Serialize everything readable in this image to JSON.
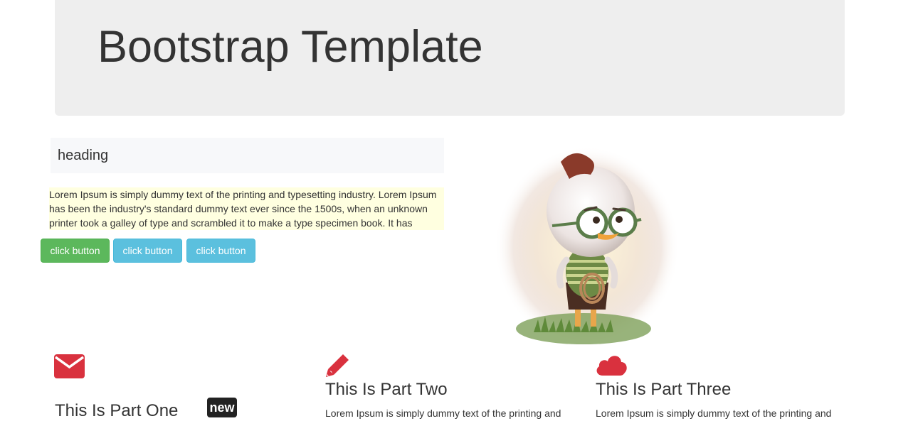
{
  "jumbotron": {
    "title": "Bootstrap Template"
  },
  "panel": {
    "heading": "heading"
  },
  "intro": {
    "text": "Lorem Ipsum is simply dummy text of the printing and typesetting industry. Lorem Ipsum has been the industry's standard dummy text ever since the 1500s, when an unknown printer took a galley of type and scrambled it to make a type specimen book. It has"
  },
  "buttons": [
    {
      "label": "click button",
      "style": "success",
      "color": "#5cb85c"
    },
    {
      "label": "click button",
      "style": "info",
      "color": "#5bc0de"
    },
    {
      "label": "click button",
      "style": "info",
      "color": "#5bc0de"
    }
  ],
  "features": [
    {
      "icon": "envelope-icon",
      "title": "This Is Part One",
      "badge": "new",
      "text": ""
    },
    {
      "icon": "pencil-icon",
      "title": "This Is Part Two",
      "text": "Lorem Ipsum is simply dummy text of the printing and"
    },
    {
      "icon": "cloud-icon",
      "title": "This Is Part Three",
      "text": "Lorem Ipsum is simply dummy text of the printing and"
    }
  ],
  "colors": {
    "icon_red": "#d9313e",
    "jumbotron_bg": "#eeeeee",
    "lorem_bg": "#ffffe0"
  }
}
